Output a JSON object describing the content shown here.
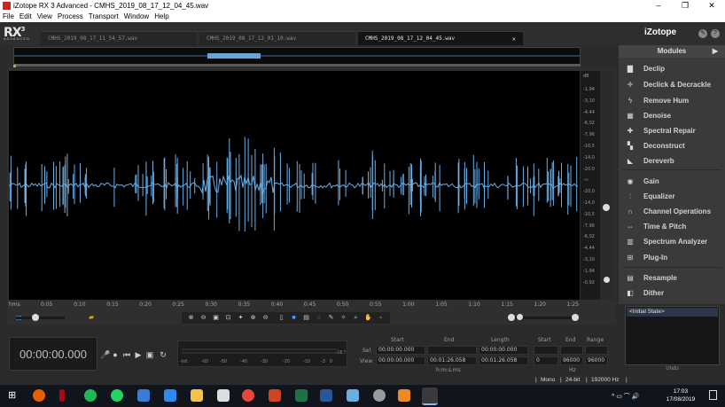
{
  "window": {
    "title": "iZotope RX 3 Advanced - CMHS_2019_08_17_12_04_45.wav",
    "controls": [
      "–",
      "❐",
      "✕"
    ]
  },
  "menu": [
    "File",
    "Edit",
    "View",
    "Process",
    "Transport",
    "Window",
    "Help"
  ],
  "app": {
    "logo": "RX",
    "logo_sup": "3",
    "logo_sub": "ADVANCED",
    "brand": "iZotope"
  },
  "tabs": [
    {
      "label": "CMHS_2019_08_17_11_54_57.wav",
      "active": false
    },
    {
      "label": "CMHS_2019_08_17_12_01_10.wav",
      "active": false
    },
    {
      "label": "CMHS_2019_08_17_12_04_45.wav",
      "active": true,
      "close": "✕"
    }
  ],
  "db_scale": {
    "top_unit": "dB",
    "labels": [
      "-1,94",
      "-3,10",
      "-4,44",
      "-6,02",
      "-7,96",
      "-10,5",
      "-14,0",
      "-20,0",
      "-∞",
      "-20,0",
      "-14,0",
      "-10,5",
      "-7,96",
      "-6,02",
      "-4,44",
      "-3,10",
      "-1,94",
      "-0,92"
    ]
  },
  "time_axis": {
    "labels": [
      "hms",
      "0:05",
      "0:10",
      "0:15",
      "0:20",
      "0:25",
      "0:30",
      "0:35",
      "0:40",
      "0:45",
      "0:50",
      "0:55",
      "1:00",
      "1:05",
      "1:10",
      "1:15",
      "1:20",
      "1:25"
    ]
  },
  "modules": {
    "header": "Modules",
    "arrow": "▶",
    "items": [
      {
        "label": "Declip",
        "icon": "declip-icon",
        "glyph": "▇"
      },
      {
        "label": "Declick & Decrackle",
        "icon": "declick-icon",
        "glyph": "✛"
      },
      {
        "label": "Remove Hum",
        "icon": "hum-icon",
        "glyph": "ϟ"
      },
      {
        "label": "Denoise",
        "icon": "denoise-icon",
        "glyph": "▦"
      },
      {
        "label": "Spectral Repair",
        "icon": "spectral-repair-icon",
        "glyph": "✚"
      },
      {
        "label": "Deconstruct",
        "icon": "deconstruct-icon",
        "glyph": "▚"
      },
      {
        "label": "Dereverb",
        "icon": "dereverb-icon",
        "glyph": "◣"
      },
      {
        "label": "Gain",
        "icon": "gain-icon",
        "glyph": "◉"
      },
      {
        "label": "Equalizer",
        "icon": "equalizer-icon",
        "glyph": "⫶"
      },
      {
        "label": "Channel Operations",
        "icon": "channel-ops-icon",
        "glyph": "∩"
      },
      {
        "label": "Time & Pitch",
        "icon": "time-pitch-icon",
        "glyph": "⇔"
      },
      {
        "label": "Spectrum Analyzer",
        "icon": "spectrum-icon",
        "glyph": "▥"
      },
      {
        "label": "Plug-In",
        "icon": "plugin-icon",
        "glyph": "⊞"
      },
      {
        "label": "Resample",
        "icon": "resample-icon",
        "glyph": "▤"
      },
      {
        "label": "Dither",
        "icon": "dither-icon",
        "glyph": "◧"
      }
    ]
  },
  "history": {
    "items": [
      "<Initial State>"
    ],
    "undo_label": "Undo"
  },
  "transport": {
    "time": "00:00:00.000",
    "meter_labels": [
      "-Inf.",
      "-60",
      "-50",
      "-40",
      "-30",
      "-20",
      "-10",
      "-3",
      "0"
    ],
    "meter_peak": "-18.7"
  },
  "selection": {
    "headers": [
      "Start",
      "End",
      "Length"
    ],
    "sel_label": "Sel",
    "view_label": "View",
    "sel_start": "00:00:00.000",
    "sel_length": "00:00:00.000",
    "view_start": "00:00:00.000",
    "view_end": "00:01:26.058",
    "view_length": "00:01:26.058",
    "unit": "h:m:s.ms",
    "freq_headers": [
      "Start",
      "End",
      "Range"
    ],
    "freq_start": "0",
    "freq_end": "96000",
    "freq_range": "96000",
    "freq_unit": "Hz"
  },
  "status": {
    "channels": "Mono",
    "bitdepth": "24-bit",
    "samplerate": "192000 Hz"
  },
  "taskbar": {
    "time": "17:03",
    "date": "17/08/2019"
  }
}
